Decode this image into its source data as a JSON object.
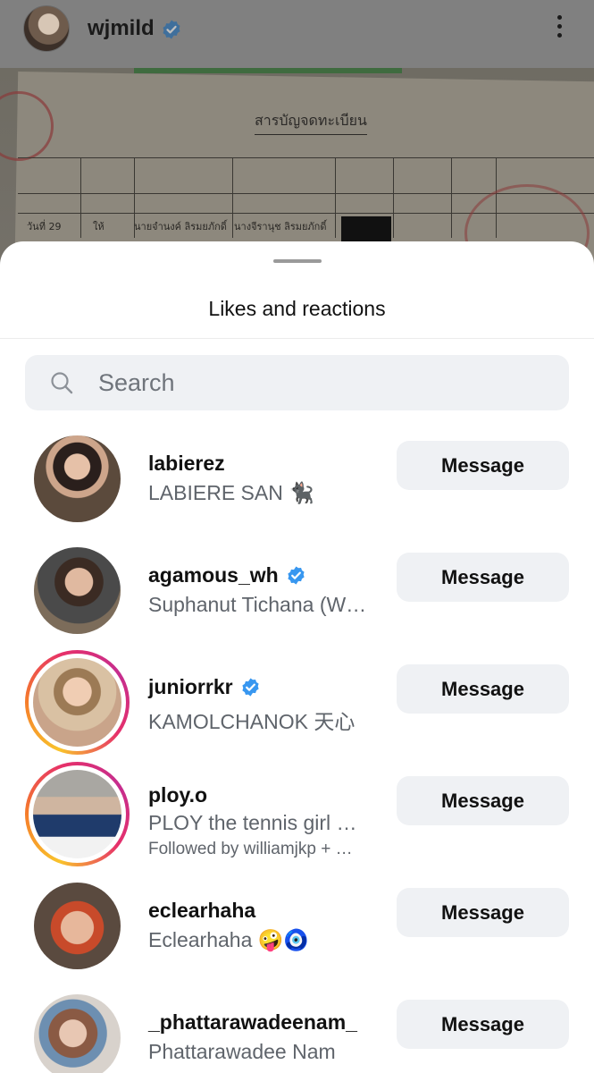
{
  "post": {
    "username": "wjmild",
    "verified": true,
    "document_title": "สารบัญจดทะเบียน",
    "document_row_day": "วันที่ 29",
    "document_row_type": "ให้",
    "document_row_person1": "นายจำนงค์ ลิรมยภักดิ์",
    "document_row_person2": "นางจีรานุช ลิรมยภักดิ์"
  },
  "sheet": {
    "title": "Likes and reactions",
    "search_placeholder": "Search"
  },
  "users": [
    {
      "username": "labierez",
      "full_name": "LABIERE SAN 🐈‍⬛",
      "verified": false,
      "story_ring": false,
      "button": "Message"
    },
    {
      "username": "agamous_wh",
      "full_name": "Suphanut Tichana (W…",
      "verified": true,
      "story_ring": false,
      "button": "Message"
    },
    {
      "username": "juniorrkr",
      "full_name": "KAMOLCHANOK 天心",
      "verified": true,
      "story_ring": true,
      "button": "Message"
    },
    {
      "username": "ploy.o",
      "full_name": "PLOY the tennis girl …",
      "followed_by": "Followed by williamjkp + …",
      "verified": false,
      "story_ring": true,
      "button": "Message"
    },
    {
      "username": "eclearhaha",
      "full_name": "Eclearhaha 🤪🧿",
      "verified": false,
      "story_ring": false,
      "button": "Message"
    },
    {
      "username": "_phattarawadeenam_",
      "full_name": "Phattarawadee Nam",
      "verified": false,
      "story_ring": false,
      "button": "Message"
    }
  ],
  "colors": {
    "verified_blue": "#3897f0",
    "button_bg": "#eff1f4",
    "secondary_text": "#5f646b"
  }
}
